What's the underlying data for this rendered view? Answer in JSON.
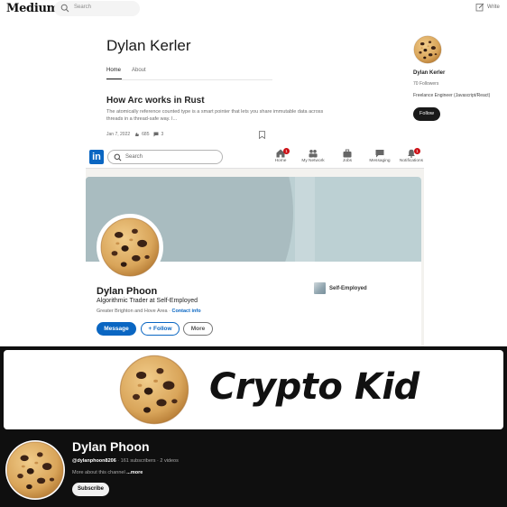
{
  "medium": {
    "logo": "Medium",
    "search_placeholder": "Search",
    "write_label": "Write",
    "profile_name": "Dylan Kerler",
    "tabs": [
      {
        "label": "Home",
        "active": true
      },
      {
        "label": "About",
        "active": false
      }
    ],
    "article": {
      "title": "How Arc works in Rust",
      "description": "The atomically reference counted type is a smart pointer that lets you share immutable data across threads in a thread-safe way. I...",
      "date": "Jan 7, 2022",
      "claps": "685",
      "comments": "3"
    },
    "sidebar": {
      "name": "Dylan Kerler",
      "followers": "70 Followers",
      "bio": "Freelance Engineer (Javascript/React)",
      "follow_label": "Follow"
    }
  },
  "linkedin": {
    "logo": "in",
    "search_placeholder": "Search",
    "nav_items": [
      {
        "label": "Home",
        "icon": "home-icon",
        "badge": "1"
      },
      {
        "label": "My Network",
        "icon": "network-icon",
        "badge": ""
      },
      {
        "label": "Jobs",
        "icon": "briefcase-icon",
        "badge": ""
      },
      {
        "label": "Messaging",
        "icon": "message-icon",
        "badge": ""
      },
      {
        "label": "Notifications",
        "icon": "bell-icon",
        "badge": "1"
      }
    ],
    "profile": {
      "name": "Dylan Phoon",
      "headline": "Algorithmic Trader at Self-Employed",
      "location": "Greater Brighton and Hove Area",
      "separator": " · ",
      "contact_link": "Contact info",
      "company": "Self-Employed"
    },
    "buttons": {
      "message": "Message",
      "follow": "+ Follow",
      "more": "More"
    },
    "colors": {
      "brand": "#0a66c2"
    }
  },
  "youtube": {
    "banner_title": "Crypto Kid",
    "channel_name": "Dylan Phoon",
    "handle": "@dylanphoon8206",
    "stats": " · 161 subscribers · 2 videos",
    "about_text": "More about this channel ",
    "about_more": "...more",
    "subscribe_label": "Subscribe"
  }
}
